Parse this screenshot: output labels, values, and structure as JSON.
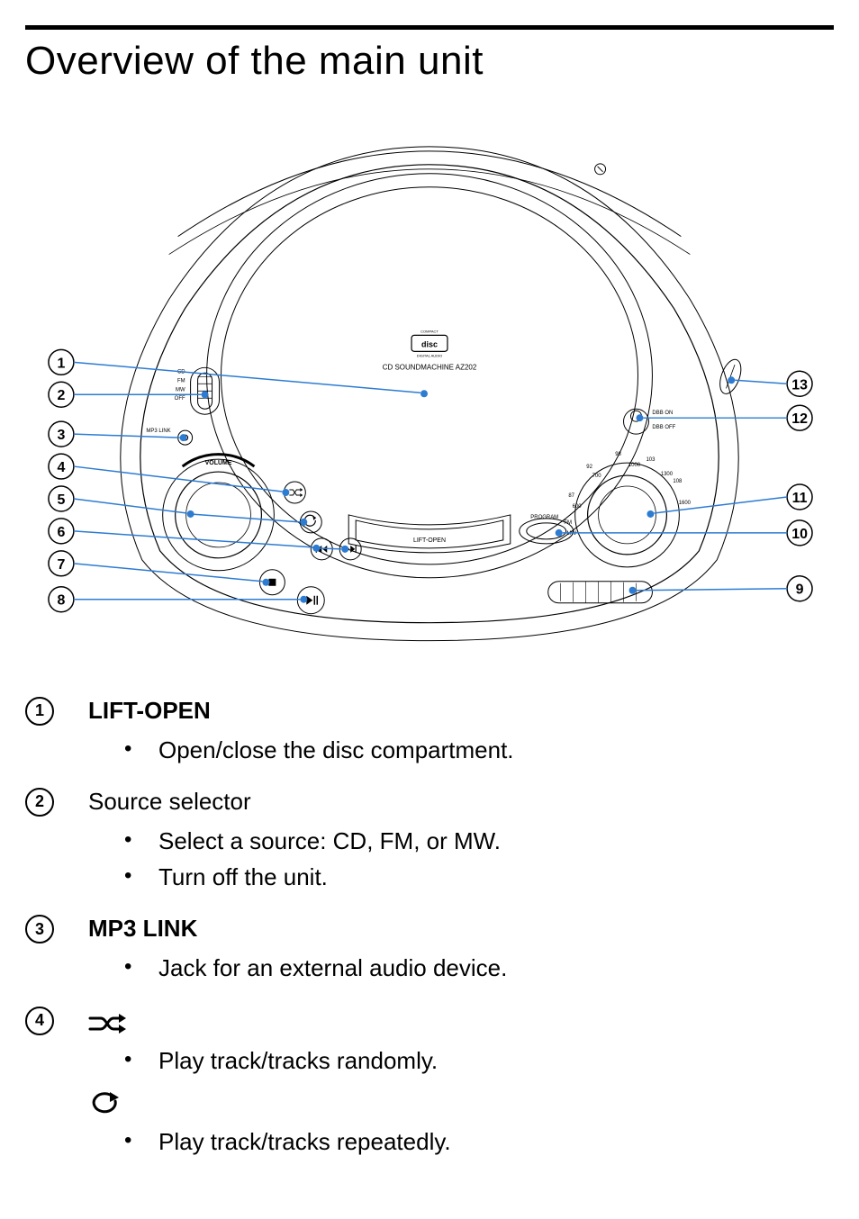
{
  "page": {
    "title": "Overview of the main unit"
  },
  "diagram": {
    "model_line": "CD SOUNDMACHINE AZ202",
    "lift_open_label": "LIFT-OPEN",
    "volume_label": "VOLUME",
    "mp3_link_label": "MP3 LINK",
    "program_label": "PROGRAM",
    "dbb_on": "DBB ON",
    "dbb_off": "DBB OFF",
    "src_cd": "CD",
    "src_fm": "FM",
    "src_mw": "MW",
    "src_off": "OFF",
    "tuner_87": "87",
    "tuner_92": "92",
    "tuner_98": "98",
    "tuner_103": "103",
    "tuner_108": "108",
    "tuner_600": "600",
    "tuner_700": "700",
    "tuner_1000": "1000",
    "tuner_1300": "1300",
    "tuner_1600": "1600",
    "tuner_fm": "FM",
    "tuner_mw": "MW",
    "callouts_left": [
      "1",
      "2",
      "3",
      "4",
      "5",
      "6",
      "7",
      "8"
    ],
    "callouts_right": [
      "13",
      "12",
      "11",
      "10",
      "9"
    ]
  },
  "defs": [
    {
      "num": "1",
      "title": "LIFT-OPEN",
      "title_style": "bold",
      "icons": [],
      "bullets": [
        "Open/close the disc compartment."
      ]
    },
    {
      "num": "2",
      "title": "Source selector",
      "title_style": "semi",
      "icons": [],
      "bullets": [
        "Select a source: CD, FM, or MW.",
        "Turn off the unit."
      ]
    },
    {
      "num": "3",
      "title": "MP3 LINK",
      "title_style": "bold",
      "icons": [],
      "bullets": [
        "Jack for an external audio device."
      ]
    },
    {
      "num": "4",
      "title": "",
      "title_style": "",
      "icons": [
        "shuffle",
        "repeat"
      ],
      "bullets_per_icon": [
        [
          "Play track/tracks randomly."
        ],
        [
          "Play track/tracks repeatedly."
        ]
      ]
    }
  ]
}
